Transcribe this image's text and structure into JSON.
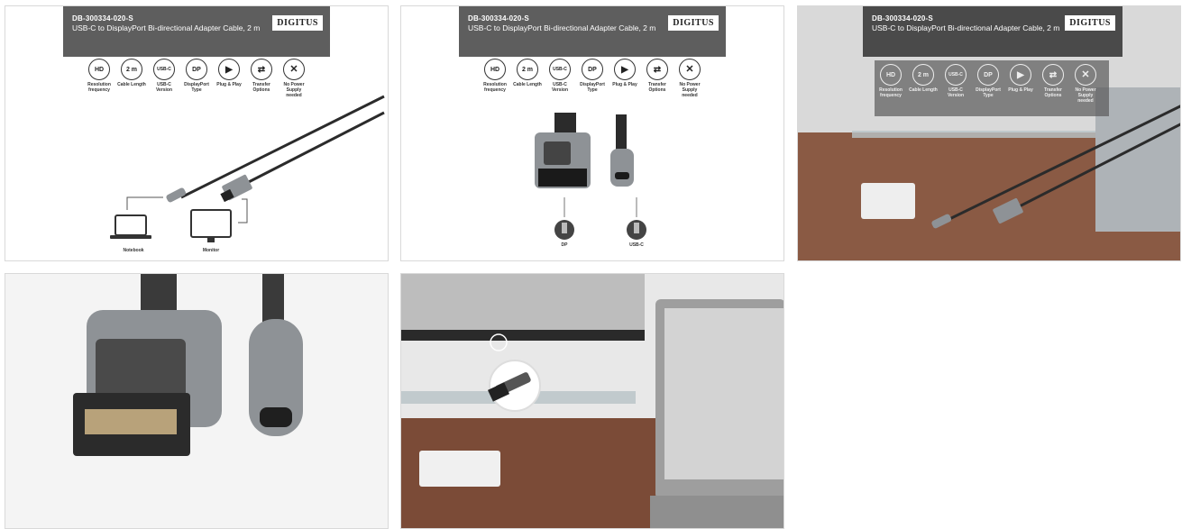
{
  "product": {
    "sku": "DB-300334-020-S",
    "description": "USB-C to DisplayPort Bi-directional Adapter Cable, 2 m",
    "brand": "DIGITUS"
  },
  "icons": [
    {
      "name": "ultra-hd-icon",
      "glyph": "HD",
      "label": "Resolution frequency"
    },
    {
      "name": "cable-length-icon",
      "glyph": "2 m",
      "label": "Cable Length"
    },
    {
      "name": "usb-c-icon",
      "glyph": "USB-C",
      "label": "USB-C Version"
    },
    {
      "name": "displayport-icon",
      "glyph": "DP",
      "label": "DisplayPort Type"
    },
    {
      "name": "plug-play-icon",
      "glyph": "▶",
      "label": "Plug & Play"
    },
    {
      "name": "transfer-icon",
      "glyph": "⇄",
      "label": "Transfer Options"
    },
    {
      "name": "no-power-icon",
      "glyph": "✕",
      "label": "No Power Supply needed"
    }
  ],
  "diagram": {
    "notebook_label": "Notebook",
    "monitor_label": "Monitor"
  },
  "connectors": {
    "dp_label": "DP",
    "usbc_label": "USB-C"
  },
  "colors": {
    "cable": "#2b2b2b",
    "housing": "#8e9296",
    "header": "#5e5e5e",
    "desk": "#8a5a44"
  }
}
